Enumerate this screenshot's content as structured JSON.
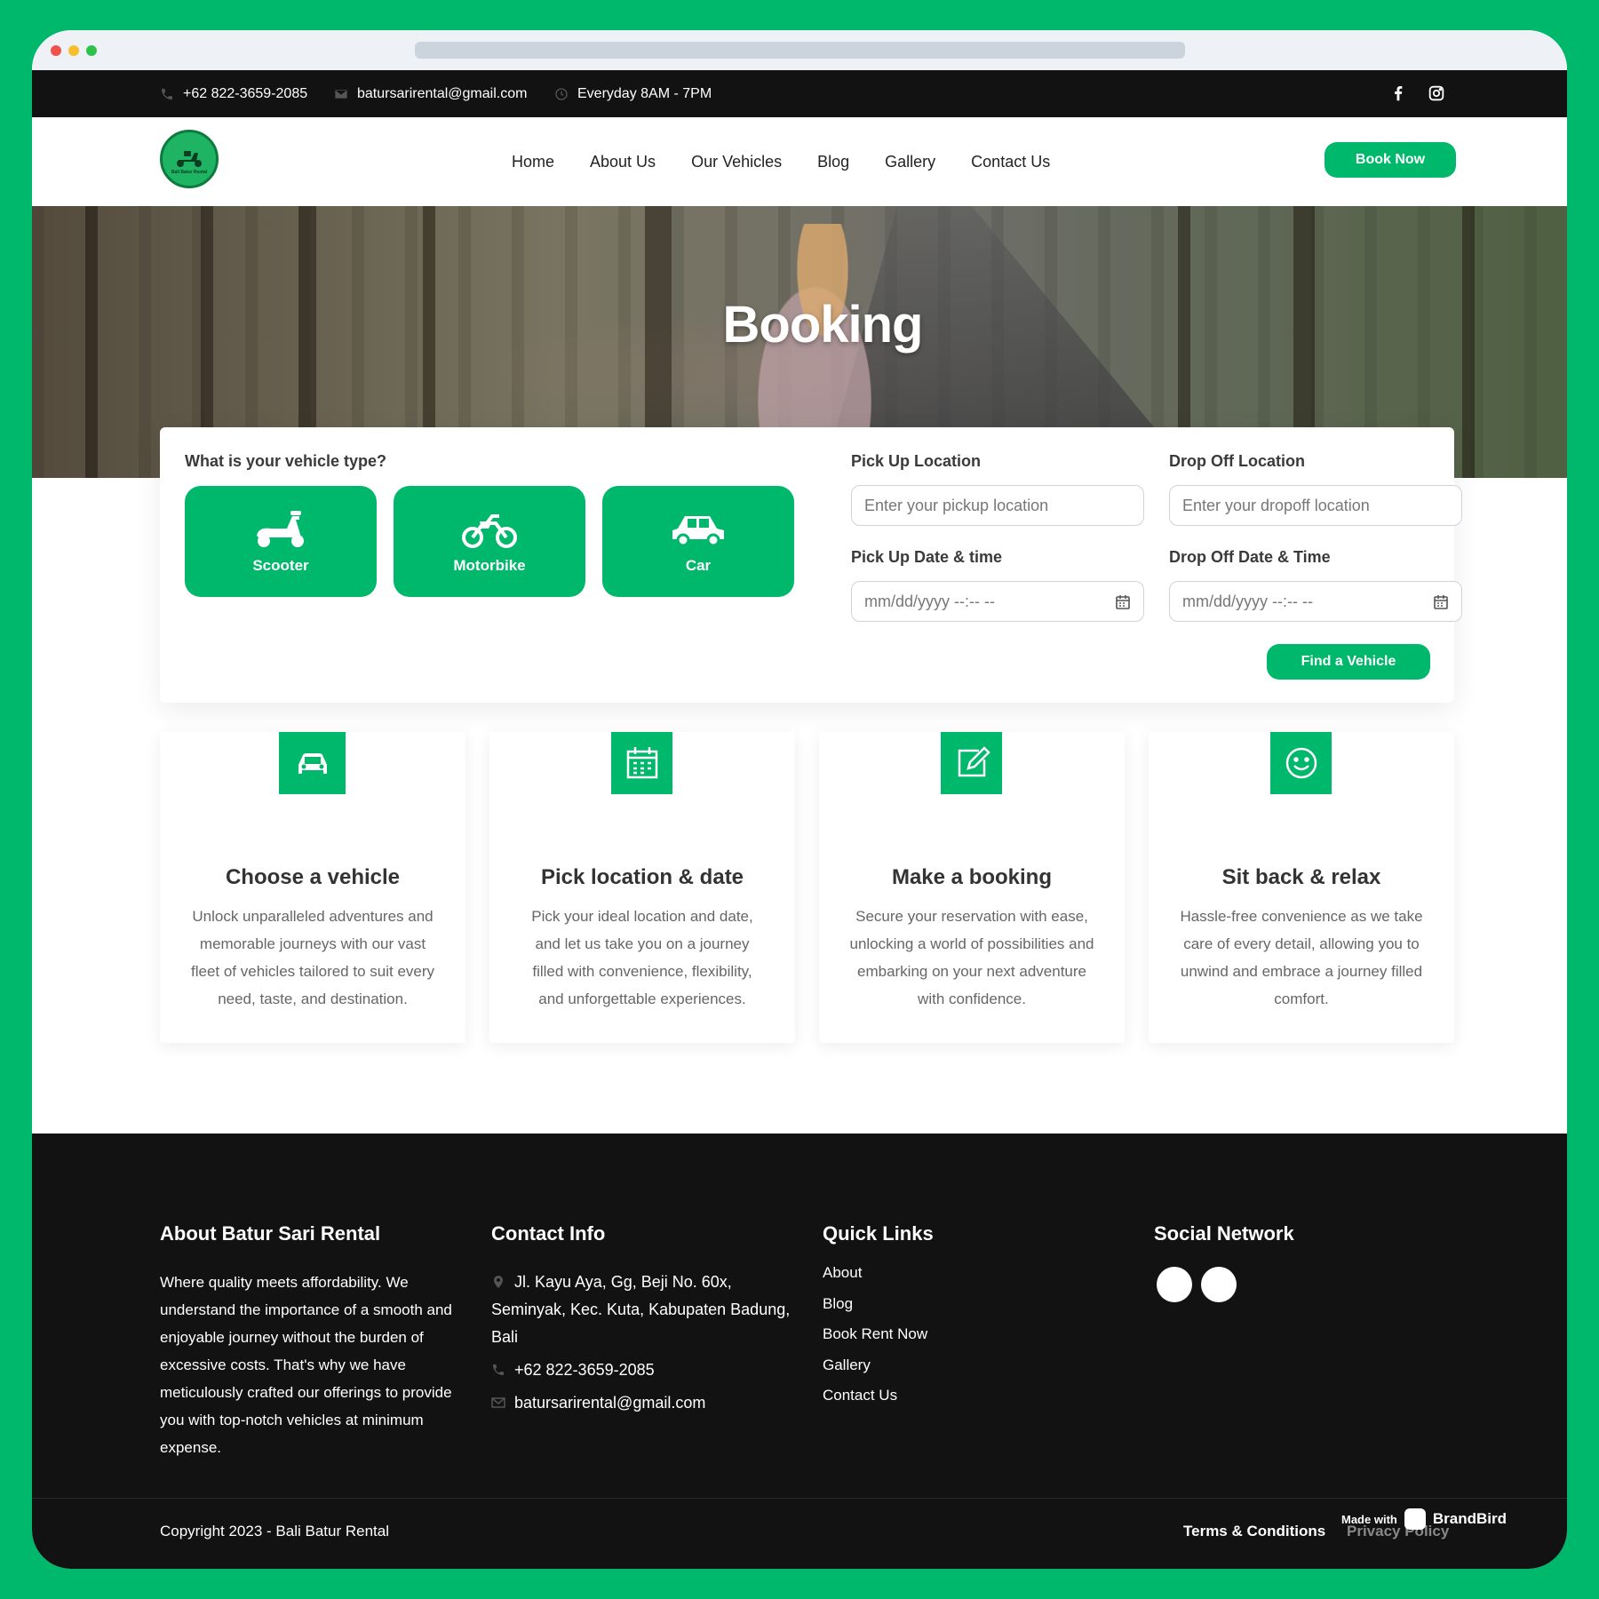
{
  "topbar": {
    "phone": "+62 822-3659-2085",
    "email": "batursarirental@gmail.com",
    "hours": "Everyday 8AM - 7PM"
  },
  "nav": {
    "links": [
      "Home",
      "About Us",
      "Our Vehicles",
      "Blog",
      "Gallery",
      "Contact Us"
    ],
    "book_now": "Book Now",
    "logo_text": "Bali Batur Rental"
  },
  "hero": {
    "title": "Booking"
  },
  "booking": {
    "vehicle_type_label": "What is your vehicle type?",
    "vehicle_types": [
      "Scooter",
      "Motorbike",
      "Car"
    ],
    "pickup_location_label": "Pick Up Location",
    "pickup_location_placeholder": "Enter your pickup location",
    "dropoff_location_label": "Drop Off Location",
    "dropoff_location_placeholder": "Enter your dropoff location",
    "pickup_datetime_label": "Pick Up Date & time",
    "pickup_datetime_value": "mm/dd/yyyy --:-- --",
    "dropoff_datetime_label": "Drop Off Date & Time",
    "dropoff_datetime_value": "mm/dd/yyyy --:-- --",
    "find_button": "Find a Vehicle"
  },
  "steps": [
    {
      "icon": "car-icon",
      "title": "Choose a vehicle",
      "desc": "Unlock unparalleled adventures and memorable journeys with our vast fleet of vehicles tailored to suit every need, taste, and destination."
    },
    {
      "icon": "calendar-icon",
      "title": "Pick location & date",
      "desc": "Pick your ideal location and date, and let us take you on a journey filled with convenience, flexibility, and unforgettable experiences."
    },
    {
      "icon": "edit-icon",
      "title": "Make a booking",
      "desc": "Secure your reservation with ease, unlocking a world of possibilities and embarking on your next adventure with confidence."
    },
    {
      "icon": "smile-icon",
      "title": "Sit back & relax",
      "desc": "Hassle-free convenience as we take care of every detail, allowing you to unwind and embrace a journey filled comfort."
    }
  ],
  "footer": {
    "about_title": "About Batur Sari Rental",
    "about_text": "Where quality meets affordability. We understand the importance of a smooth and enjoyable journey without the burden of excessive costs. That's why we have meticulously crafted our offerings to provide you with top-notch vehicles at minimum expense.",
    "contact_title": "Contact Info",
    "address": "Jl. Kayu Aya, Gg, Beji No. 60x, Seminyak, Kec. Kuta, Kabupaten Badung, Bali",
    "phone": "+62 822-3659-2085",
    "email": "batursarirental@gmail.com",
    "quick_links_title": "Quick Links",
    "quick_links": [
      "About",
      "Blog",
      "Book Rent Now",
      "Gallery",
      "Contact Us"
    ],
    "social_title": "Social Network",
    "copyright": "Copyright 2023 - Bali Batur Rental",
    "terms": "Terms & Conditions",
    "privacy": "Privacy Policy",
    "made_with": "Made with",
    "brand": "BrandBird"
  }
}
